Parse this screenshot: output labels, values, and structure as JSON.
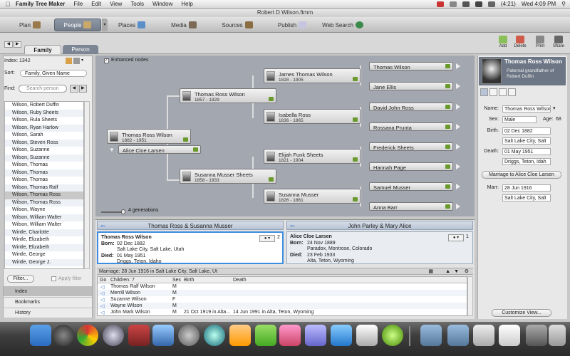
{
  "menubar": {
    "app": "Family Tree Maker",
    "menus": [
      "File",
      "Edit",
      "View",
      "Tools",
      "Window",
      "Help"
    ],
    "battery": "(4:21)",
    "clock": "Wed 4:09 PM"
  },
  "window": {
    "title": "Robert D Wilson.ftmm"
  },
  "modes": [
    "Plan",
    "People",
    "Places",
    "Media",
    "Sources",
    "Publish",
    "Web Search"
  ],
  "tabs": {
    "family": "Family",
    "person": "Person"
  },
  "tools": {
    "add": "Add",
    "delete": "Delete",
    "print": "Print",
    "share": "Share"
  },
  "index": {
    "label": "Index: 1342",
    "sort_label": "Sort:",
    "sort_value": "Family, Given Name",
    "find_label": "Find:",
    "find_placeholder": "Search person",
    "people": [
      "Wilson, Robert Duffin",
      "Wilson, Ruby Sheets",
      "Wilson, Rula Sheets",
      "Wilson, Ryan Harlow",
      "Wilson, Sarah",
      "Wilson, Steven Ross",
      "Wilson, Suzanne",
      "Wilson, Suzanne",
      "Wilson, Thomas",
      "Wilson, Thomas",
      "Wilson, Thomas",
      "Wilson, Thomas Ralf",
      "Wilson, Thomas Ross",
      "Wilson, Thomas Ross",
      "Wilson, Wayne",
      "Wilson, William Walter",
      "Wilson, William Walter",
      "Wintle, Charlotte",
      "Wintle, Elizabeth",
      "Wintle, Elizabeth",
      "Wintle, George",
      "Wintle, George J."
    ],
    "filter_button": "Filter...",
    "apply_filter": "Apply filter",
    "nav": [
      "Index",
      "Bookmarks",
      "History"
    ]
  },
  "tree": {
    "enhanced_label": "Enhanced nodes",
    "generations": "4 generations",
    "root": {
      "name": "Thomas Ross Wilson",
      "dates": "1882 - 1951"
    },
    "spouse": "Alice Cloe Larsen",
    "father": {
      "name": "Thomas Ross Wilson",
      "dates": "1857 - 1929"
    },
    "mother": {
      "name": "Susanna Musser Sheets",
      "dates": "1858 - 1933"
    },
    "gp1": {
      "name": "James Thomas Wilson",
      "dates": "1828 - 1905"
    },
    "gp2": {
      "name": "Isabella Ross",
      "dates": "1836 - 1865"
    },
    "gp3": {
      "name": "Elijah Funk Sheets",
      "dates": "1821 - 1904"
    },
    "gp4": {
      "name": "Susanna Musser",
      "dates": "1826 - 1861"
    },
    "ggp": [
      "Thomas Wilson",
      "Jane Ellis",
      "David John Ross",
      "Rossana Prunta",
      "Frederick Sheets",
      "Hannah Page",
      "Samuel Musser",
      "Anna Barr"
    ]
  },
  "family": {
    "left_header": "Thomas Ross & Susanna Musser",
    "right_header": "John Parley & Mary Alice",
    "left_card": {
      "name": "Thomas Ross Wilson",
      "born_label": "Born:",
      "born_date": "02 Dec 1882",
      "born_place": "Salt Lake City, Salt Lake, Utah",
      "died_label": "Died:",
      "died_date": "01 May 1951",
      "died_place": "Driggs, Teton, Idaho",
      "count": "2"
    },
    "right_card": {
      "name": "Alice Cloe Larsen",
      "born_label": "Born:",
      "born_date": "24 Nov 1889",
      "born_place": "Paradox, Montrose, Colorado",
      "died_label": "Died:",
      "died_date": "23 Feb 1933",
      "died_place": "Alta, Teton, Wyoming",
      "count": "1"
    },
    "marriage": "Marriage: 28 Jun 1916 in Salt Lake City, Salt Lake, Ut",
    "children_headers": {
      "go": "Go",
      "children": "Children: 7",
      "sex": "Sex",
      "birth": "Birth",
      "death": "Death"
    },
    "children": [
      {
        "name": "Thomas Ralf Wilson",
        "sex": "M",
        "birth": "",
        "death": ""
      },
      {
        "name": "Merrill Wilson",
        "sex": "M",
        "birth": "",
        "death": ""
      },
      {
        "name": "Suzanne Wilson",
        "sex": "F",
        "birth": "",
        "death": ""
      },
      {
        "name": "Wayne Wilson",
        "sex": "M",
        "birth": "",
        "death": ""
      },
      {
        "name": "John Mark Wilson",
        "sex": "M",
        "birth": "21 Oct 1919 in Alta...",
        "death": "14 Jun 1991 in Alta, Teton, Wyoming"
      }
    ]
  },
  "editor": {
    "name": "Thomas Ross Wilson",
    "relation": "Paternal grandfather of Robert Duffin",
    "name_label": "Name:",
    "name_value": "Thomas Ross Wilson",
    "sex_label": "Sex:",
    "sex_value": "Male",
    "age_label": "Age:",
    "age_value": "68",
    "birth_label": "Birth:",
    "birth_date": "02 Dec 1882",
    "birth_place": "Salt Lake City, Salt",
    "death_label": "Death:",
    "death_date": "01 May 1951",
    "death_place": "Driggs, Teton, Idah",
    "marriage_button": "Marriage to Alice Cloe Larsen",
    "marr_label": "Marr:",
    "marr_date": "28 Jun 1916",
    "marr_place": "Salt Lake City, Salt",
    "customize": "Customize View..."
  },
  "colors": {
    "accent": "#3d8de0",
    "tree_bg": "#a3a7b0",
    "leaf": "#6a9a2c",
    "selected_mode": "#7f8997"
  }
}
